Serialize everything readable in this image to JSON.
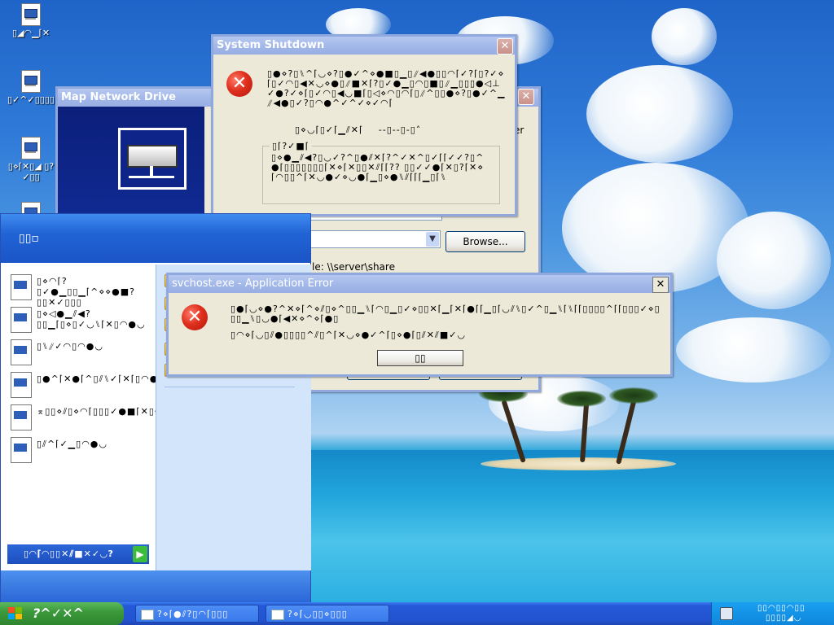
{
  "desktop_icons": [
    {
      "label": "▯◢◠▁⌈✕"
    },
    {
      "label": "▯✓^✓▯▯▯▯"
    },
    {
      "label": "▯⋄⌈✕▯◢ ▯?✓▯▯"
    },
    {
      "label": ""
    }
  ],
  "map_network_drive": {
    "title": "Map Network Drive",
    "partial_label_er": "er",
    "folder_hint": "le: \\\\server\\share",
    "browse_label": "Browse..."
  },
  "system_shutdown": {
    "title": "System Shutdown",
    "close_glyph": "✕",
    "message": "▯●⋄?▯⑊^⌈◡⋄?▯●✓^⋄●■▯▁▯⫽◀●▯▯◠⌈✓?⌈▯?✓⋄⌈▯✓◠▯◀✕◡⋄●▯⫽■✕⌈?▯✓●▁▯◠▯■▯⫽▁▯▯▯●◁⊥✓●?✓⋄⌈▯✓◠▯◀◡■⌈▯◁⋄◠▯◠⌈▯⫽^▯▯●⋄?▯●✓^▁⫽◀●▯✓?▯◠●^✓^✓⋄✓◠⌈",
    "time_label": "▯⋄◡⌈▯✓⌈▁⫽✕⌈",
    "time_value": "‑‑▯‑‑▯‑▯˄",
    "group_title": "▯⌈?✓■⌈",
    "group_text": "▯⋄●▁⫽◀?▯◡✓?^▯●⫽✕⌈?^✓✕^▯✓⌈⌈✓✓?▯^●⌈▯▯▯▯▯▯▯⌈✕⋄⌈✕▯▯✕⫽⌈⌈?? ▯▯✓✓●⌈✕▯?⌈✕⋄⌈◠▯▯^⌈✕◡●✓⋄◡●⌈▁▯⋄●⑊⫽⌈⌈⌈▁▯⌈⑊"
  },
  "svchost_error": {
    "title": "svchost.exe - Application Error",
    "close_glyph": "✕",
    "message_line1": "▯●⌈◡⋄●?^✕⋄⌈^⋄⫽▯⋄^▯▯▁⑊⌈◠▯▁▯✓⋄▯▯✕⌈▁⌈✕⌈●⌈⌈▁▯⌈◡⫽⑊▯✓^▯▁⑊⌈⑊⌈⌈▯▯▯▯^⌈⌈▯▯▯✓⋄▯▯▯▁⑊▯◡●⌈◀✕⋄^⋄⌈●▯",
    "message_line2": "▯◠⋄⌈◡▯⫽●▯▯▯▯^⫽▯^⌈✕◡⋄●✓^⌈▯⋄●⌈▯⫽✕⫽■✓◡",
    "ok_label": "▯▯"
  },
  "start_menu": {
    "user_name": "▯▯▫",
    "programs": [
      {
        "label": "▯⋄◠⌈?▯✓●▁▯▯▁⌈^⋄⋄●■?▯▯✕✓▯▯▯"
      },
      {
        "label": "▯⋄◁●▁⫽◀?▯▯▁⌈▯⋄▯✓◡⑊⌈✕▯◠●◡"
      },
      {
        "label": "▯⑊⫽✓◠▯◠●◡"
      },
      {
        "label": "▯●^⌈✕●⌈^▯⫽⑊✓⌈✕⌈▯◠●◡"
      },
      {
        "label": "⌅▯▯⋄⫽▯⋄◠⌈▯▯▯✓●■⌈✕▯◠●◡"
      },
      {
        "label": "▯⫽^⌈✓▁▯◠●◡"
      }
    ],
    "places": [
      {
        "label": ""
      },
      {
        "label": ""
      },
      {
        "label": ""
      },
      {
        "label": "▯⫽●^✕⫽▯▯✓●⌈"
      },
      {
        "label": "▯✕⋄●^⌈✕?▯✓●▁▯✓⑊⌈?"
      }
    ],
    "all_programs_label": "▯◠⌈◠▯▯✕⫽■✕✓◡?"
  },
  "taskbar": {
    "start_label": "?^✓✕^",
    "buttons": [
      {
        "label": "?⋄⌈●⫽?▯◠⌈▯▯▯"
      },
      {
        "label": "?⋄⌈◡▯▯⋄▯▯▯"
      }
    ],
    "clock": "▯▯◠▯▯◠▯▯",
    "clock_sub": "▯▯▯▯◢◡"
  }
}
